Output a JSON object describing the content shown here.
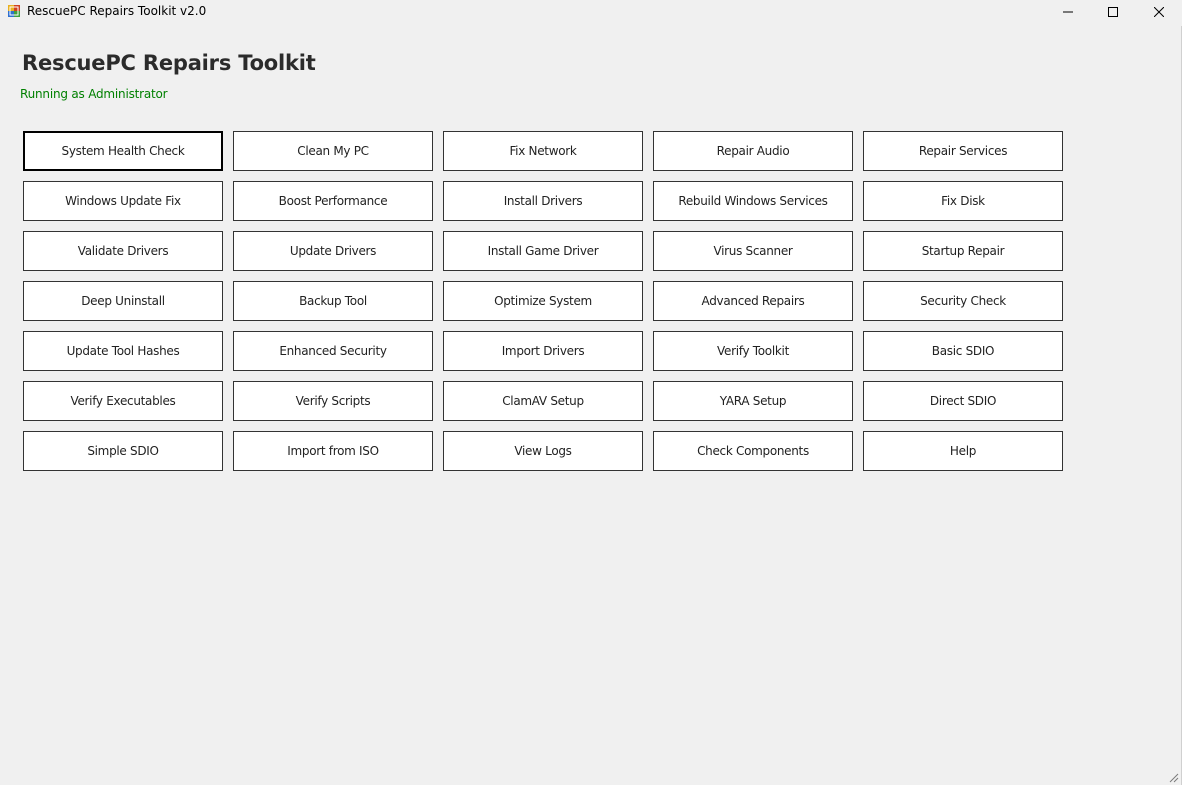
{
  "window": {
    "title": "RescuePC Repairs Toolkit v2.0"
  },
  "header": {
    "title": "RescuePC Repairs Toolkit",
    "status": "Running as Administrator"
  },
  "colors": {
    "background": "#f0f0f0",
    "status_text": "#008000",
    "button_border": "#333333",
    "button_fill": "#ffffff"
  },
  "buttons": [
    {
      "label": "System Health Check",
      "focused": true
    },
    {
      "label": "Clean My PC"
    },
    {
      "label": "Fix Network"
    },
    {
      "label": "Repair Audio"
    },
    {
      "label": "Repair Services"
    },
    {
      "label": "Windows Update Fix"
    },
    {
      "label": "Boost Performance"
    },
    {
      "label": "Install Drivers"
    },
    {
      "label": "Rebuild Windows Services"
    },
    {
      "label": "Fix Disk"
    },
    {
      "label": "Validate Drivers"
    },
    {
      "label": "Update Drivers"
    },
    {
      "label": "Install Game Driver"
    },
    {
      "label": "Virus Scanner"
    },
    {
      "label": "Startup Repair"
    },
    {
      "label": "Deep Uninstall"
    },
    {
      "label": "Backup Tool"
    },
    {
      "label": "Optimize System"
    },
    {
      "label": "Advanced Repairs"
    },
    {
      "label": "Security Check"
    },
    {
      "label": "Update Tool Hashes"
    },
    {
      "label": "Enhanced Security"
    },
    {
      "label": "Import Drivers"
    },
    {
      "label": "Verify Toolkit"
    },
    {
      "label": "Basic SDIO"
    },
    {
      "label": "Verify Executables"
    },
    {
      "label": "Verify Scripts"
    },
    {
      "label": "ClamAV Setup"
    },
    {
      "label": "YARA Setup"
    },
    {
      "label": "Direct SDIO"
    },
    {
      "label": "Simple SDIO"
    },
    {
      "label": "Import from ISO"
    },
    {
      "label": "View Logs"
    },
    {
      "label": "Check Components"
    },
    {
      "label": "Help"
    }
  ]
}
